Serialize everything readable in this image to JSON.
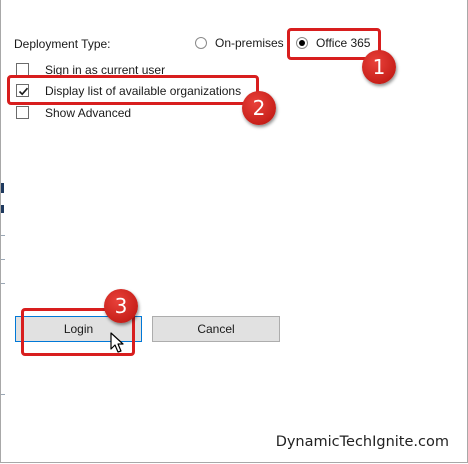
{
  "deployment": {
    "label": "Deployment Type:",
    "options": [
      {
        "label": "On-premises",
        "selected": false
      },
      {
        "label": "Office 365",
        "selected": true
      }
    ]
  },
  "options": [
    {
      "label": "Sign in as current user",
      "checked": false
    },
    {
      "label": "Display list of available organizations",
      "checked": true
    },
    {
      "label": "Show Advanced",
      "checked": false
    }
  ],
  "buttons": {
    "login": "Login",
    "cancel": "Cancel"
  },
  "annotations": {
    "callout_1": "1",
    "callout_2": "2",
    "callout_3": "3",
    "color": "#d81e1e"
  },
  "watermark": "DynamicTechIgnite.com"
}
